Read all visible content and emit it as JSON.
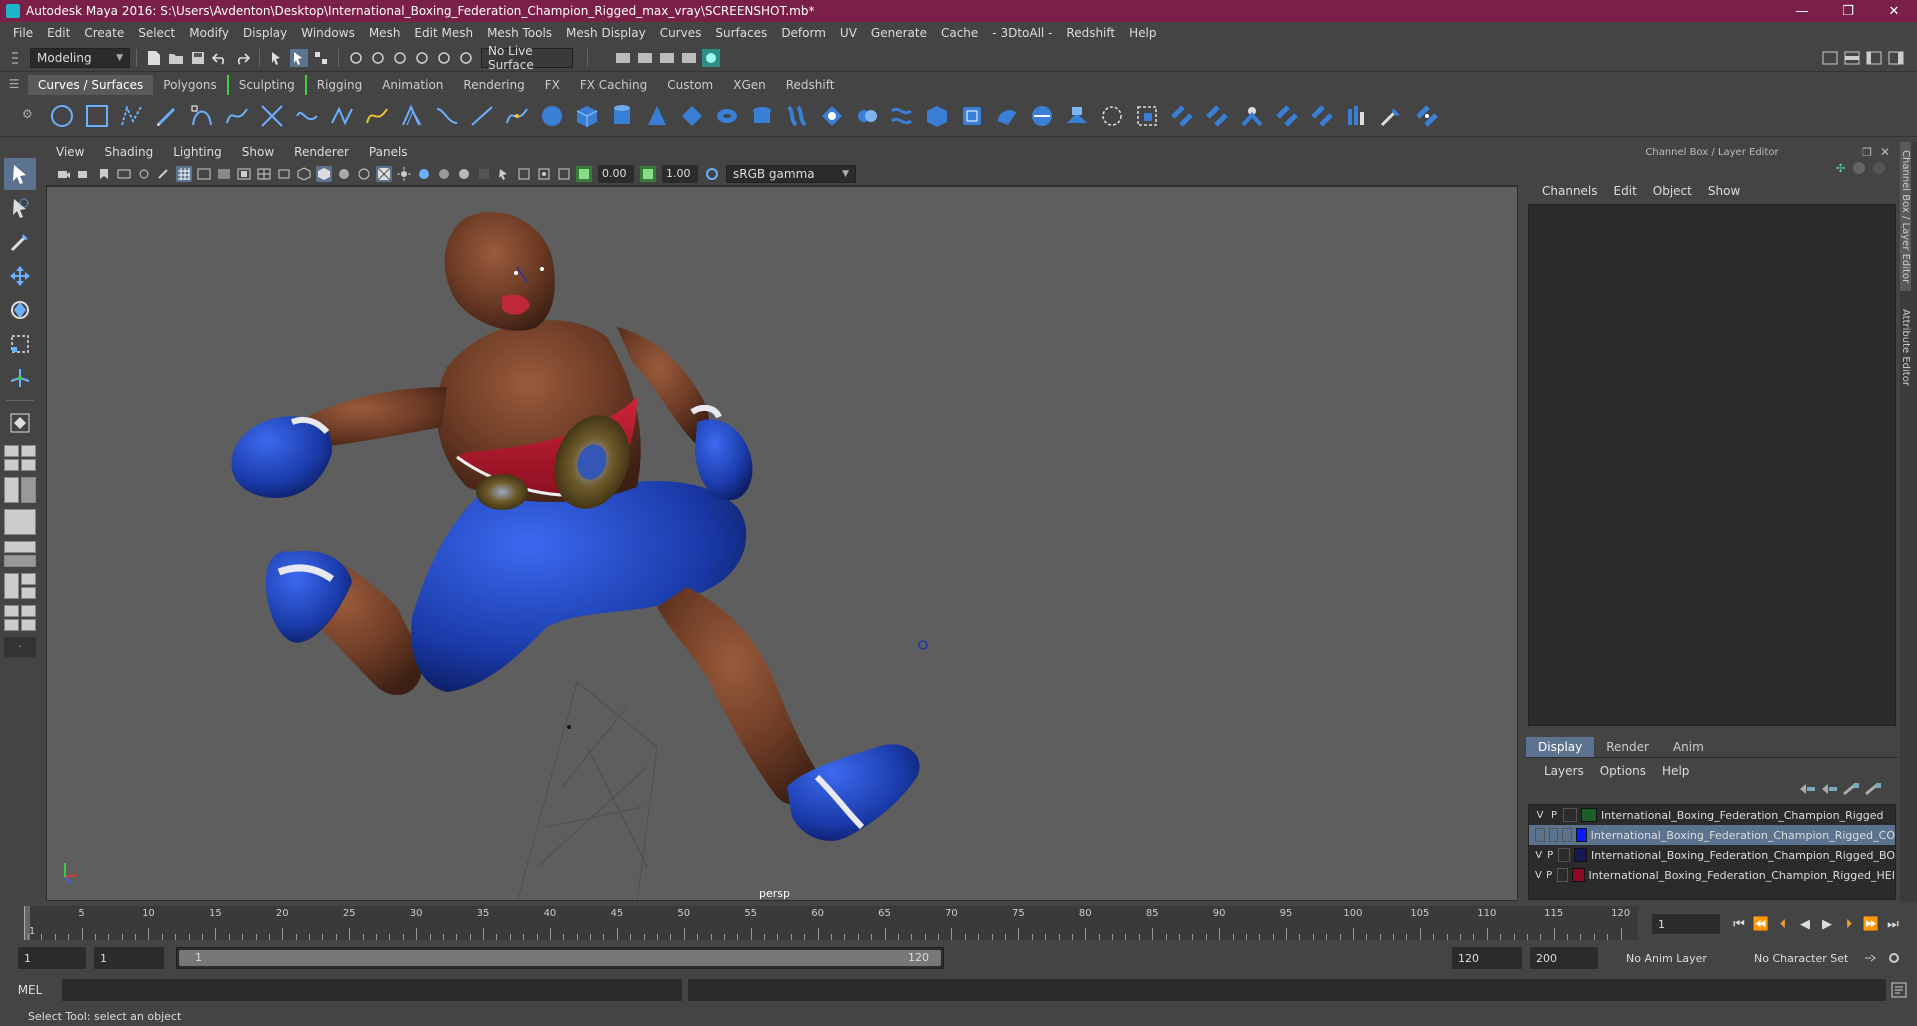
{
  "title": "Autodesk Maya 2016: S:\\Users\\Avdenton\\Desktop\\International_Boxing_Federation_Champion_Rigged_max_vray\\SCREENSHOT.mb*",
  "window_buttons": [
    "—",
    "❐",
    "✕"
  ],
  "menus": [
    "File",
    "Edit",
    "Create",
    "Select",
    "Modify",
    "Display",
    "Windows",
    "Mesh",
    "Edit Mesh",
    "Mesh Tools",
    "Mesh Display",
    "Curves",
    "Surfaces",
    "Deform",
    "UV",
    "Generate",
    "Cache",
    "- 3DtoAll -",
    "Redshift",
    "Help"
  ],
  "status": {
    "mode": "Modeling",
    "live_surface": "No Live Surface"
  },
  "shelf_tabs": [
    {
      "label": "Curves / Surfaces",
      "active": true
    },
    {
      "label": "Polygons"
    },
    {
      "label": "Sculpting",
      "green": true
    },
    {
      "label": "Rigging",
      "green": true
    },
    {
      "label": "Animation"
    },
    {
      "label": "Rendering"
    },
    {
      "label": "FX"
    },
    {
      "label": "FX Caching"
    },
    {
      "label": "Custom"
    },
    {
      "label": "XGen"
    },
    {
      "label": "Redshift"
    }
  ],
  "viewport": {
    "menus": [
      "View",
      "Shading",
      "Lighting",
      "Show",
      "Renderer",
      "Panels"
    ],
    "exposure": "0.00",
    "gamma": "1.00",
    "colorspace": "sRGB gamma",
    "camera_label": "persp"
  },
  "right_panel": {
    "header": "Channel Box / Layer Editor",
    "menus": [
      "Channels",
      "Edit",
      "Object",
      "Show"
    ],
    "tabs": [
      "Display",
      "Render",
      "Anim"
    ],
    "sub_menus": [
      "Layers",
      "Options",
      "Help"
    ],
    "side_tabs": [
      "Channel Box / Layer Editor",
      "Attribute Editor"
    ],
    "layers": [
      {
        "v": "V",
        "p": "P",
        "color": "#1b5e2a",
        "name": "International_Boxing_Federation_Champion_Rigged",
        "selected": false
      },
      {
        "v": "",
        "p": "",
        "color": "#0a1aff",
        "name": "International_Boxing_Federation_Champion_Rigged_CO",
        "selected": true
      },
      {
        "v": "V",
        "p": "P",
        "color": "#141a55",
        "name": "International_Boxing_Federation_Champion_Rigged_BO",
        "selected": false
      },
      {
        "v": "V",
        "p": "P",
        "color": "#8a0a26",
        "name": "International_Boxing_Federation_Champion_Rigged_HEI",
        "selected": false
      }
    ]
  },
  "timeline": {
    "labels": [
      "5",
      "10",
      "15",
      "20",
      "25",
      "30",
      "35",
      "40",
      "45",
      "50",
      "55",
      "60",
      "65",
      "70",
      "75",
      "80",
      "85",
      "90",
      "95",
      "100",
      "105",
      "110",
      "115",
      "120"
    ],
    "current_frame_label": "1",
    "current_frame": "1"
  },
  "range": {
    "start": "1",
    "playback_start": "1",
    "slider_left": "1",
    "slider_right": "120",
    "playback_end": "120",
    "end": "200",
    "anim_layer": "No Anim Layer",
    "character_set": "No Character Set"
  },
  "cmdline": {
    "label": "MEL"
  },
  "helpline": "Select Tool: select an object"
}
